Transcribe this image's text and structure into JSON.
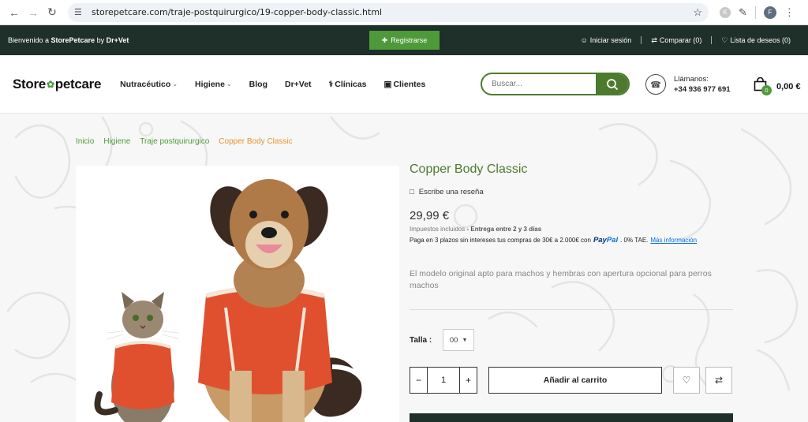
{
  "browser": {
    "url": "storepetcare.com/traje-postquirurgico/19-copper-body-classic.html",
    "ext_letter": "K",
    "profile_letter": "F"
  },
  "topbar": {
    "welcome_prefix": "Bienvenido a ",
    "welcome_brand": "StorePetcare",
    "welcome_suffix": " by ",
    "welcome_partner": "Dr+Vet",
    "register": "Registrarse",
    "login": "Iniciar sesión",
    "compare": "Comparar (0)",
    "wishlist": "Lista de deseos (0)"
  },
  "header": {
    "logo_left": "Store",
    "logo_right": "petcare",
    "menu": [
      "Nutracéutico",
      "Higiene",
      "Blog",
      "Dr+Vet",
      "Clínicas",
      "Clientes"
    ],
    "search_placeholder": "Buscar...",
    "call_label": "Llámanos:",
    "phone": "+34 936 977 691",
    "cart_count": "0",
    "cart_total": "0,00 €"
  },
  "breadcrumb": [
    "Inicio",
    "Higiene",
    "Traje postquirurgico",
    "Copper Body Classic"
  ],
  "product": {
    "title": "Copper Body Classic",
    "review": "Escribe una reseña",
    "price": "29,99 €",
    "tax": "Impuestos incluidos",
    "delivery": "- Entrega entre 2 y 3 días",
    "paypal_text": "Paga en 3 plazos sin intereses tus compras de 30€ a 2.000€ con",
    "paypal_brand_a": "Pay",
    "paypal_brand_b": "Pal",
    "paypal_tae": ". 0% TAE.",
    "more_info": "Más información",
    "description": "El modelo original apto para machos y hembras con apertura opcional para perros machos",
    "size_label": "Talla :",
    "size_value": "00",
    "qty": "1",
    "minus": "−",
    "plus": "+",
    "add_to_cart": "Añadir al carrito"
  },
  "colors": {
    "brand_green": "#4e9a3a",
    "dark": "#1f2f2a",
    "accent_orange": "#e8952a",
    "suit_orange": "#e0502e"
  }
}
